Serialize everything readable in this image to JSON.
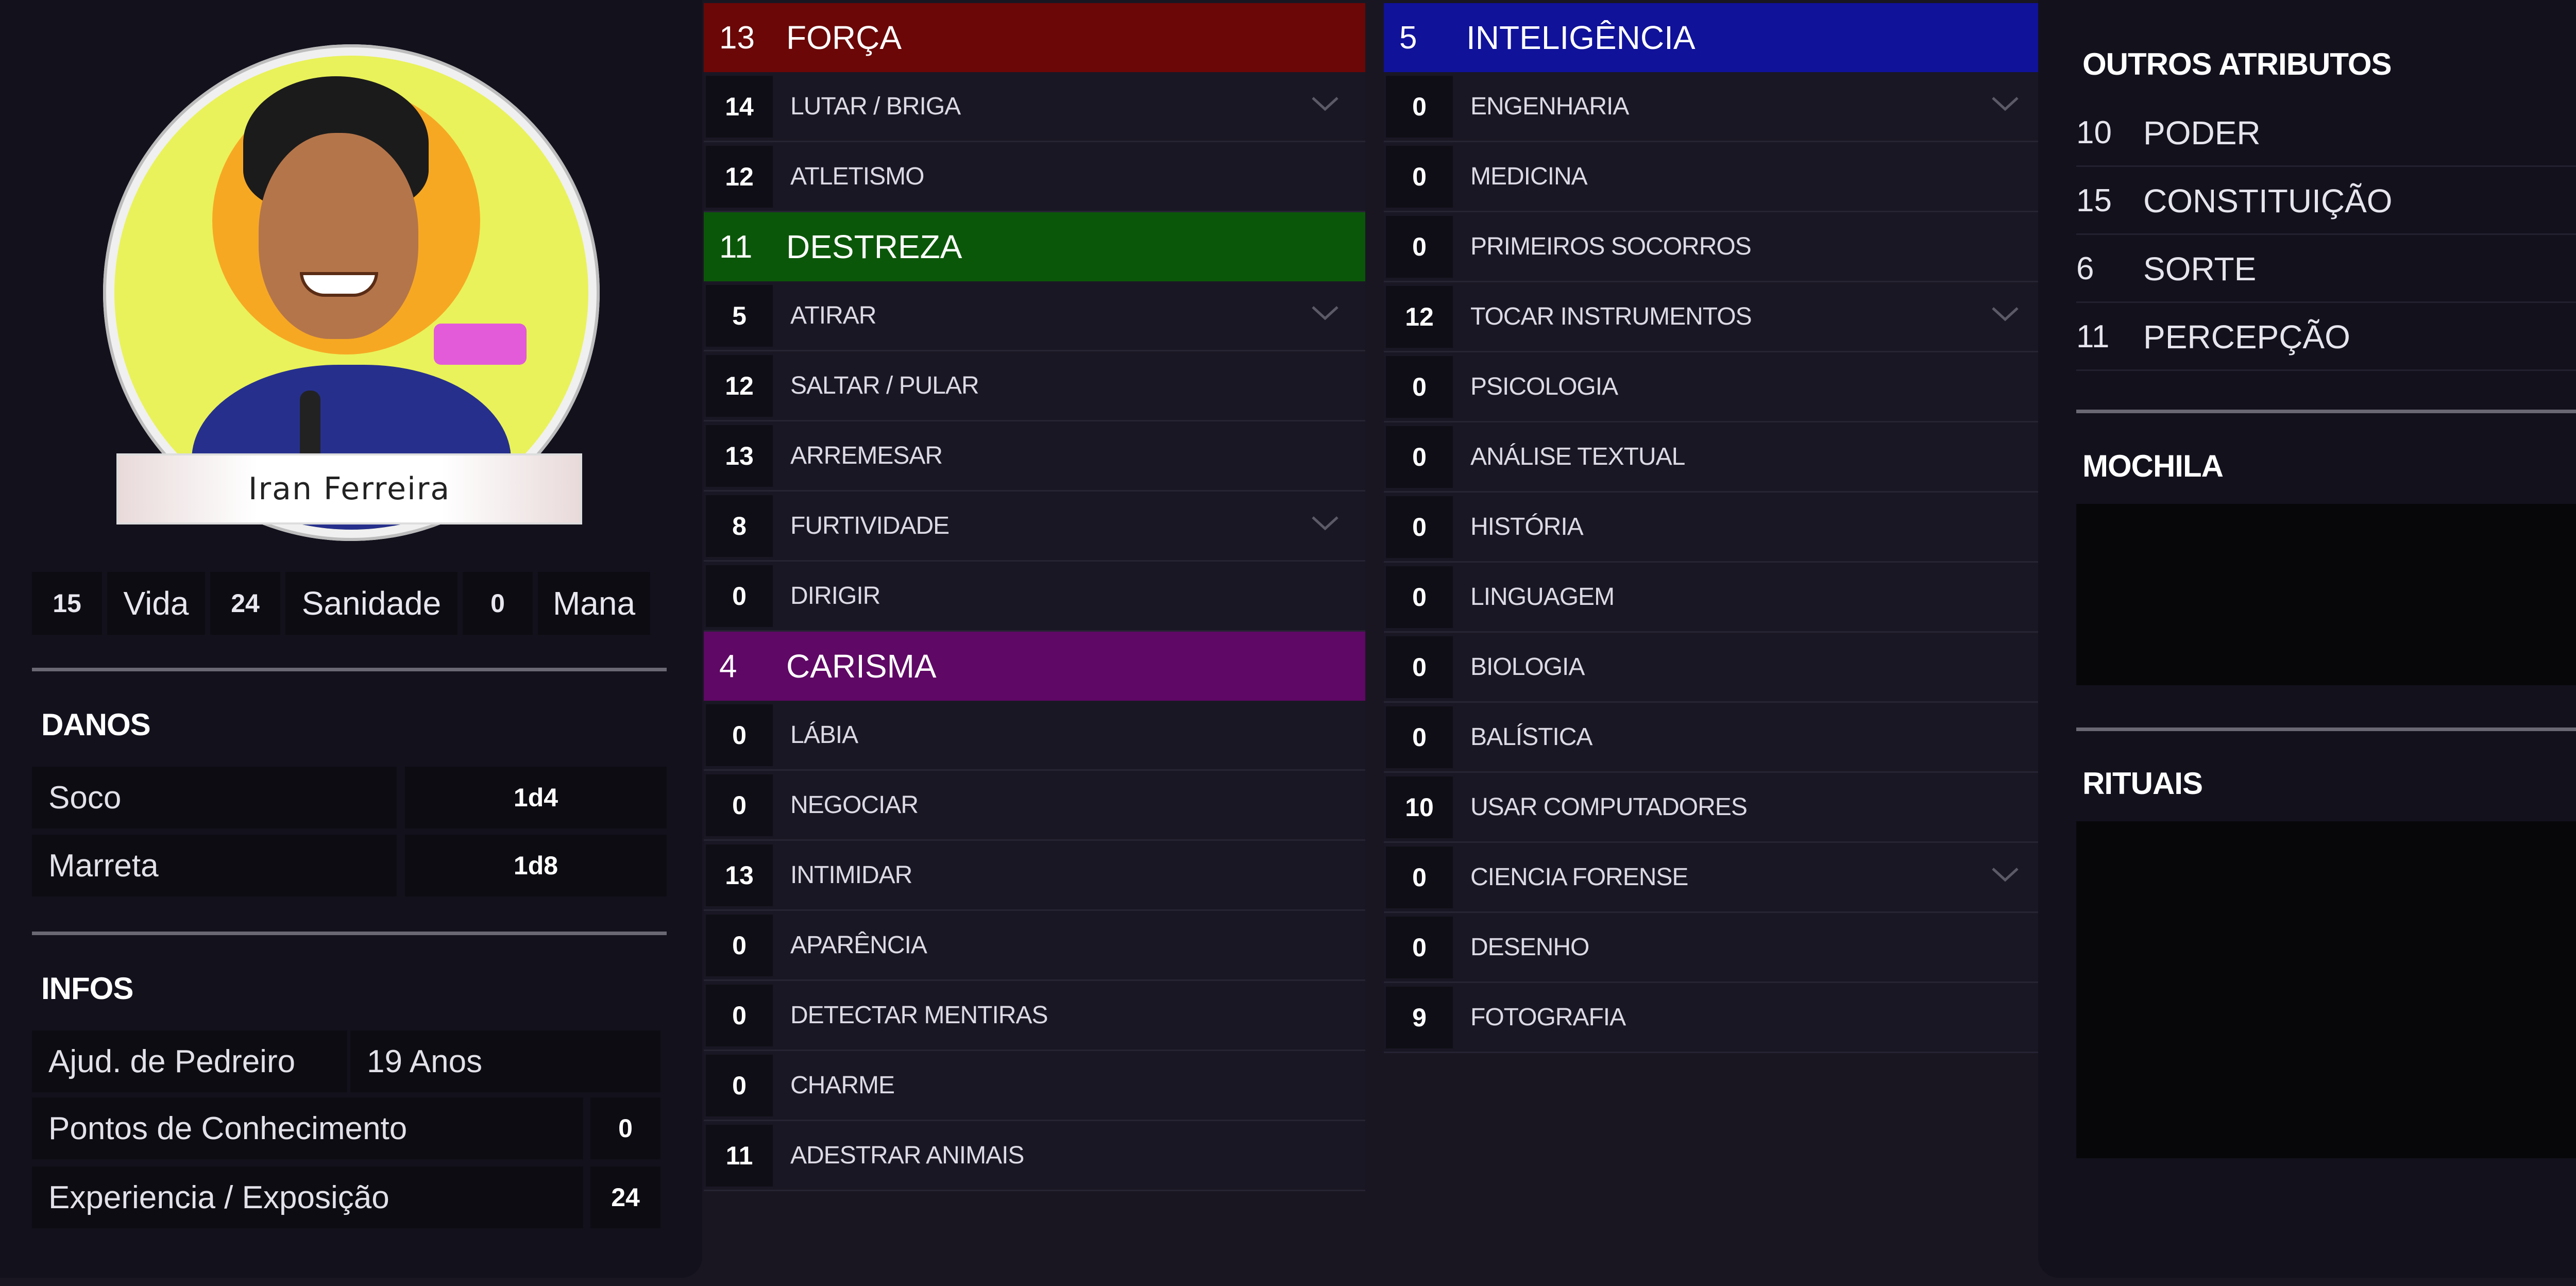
{
  "character": {
    "name": "Iran Ferreira"
  },
  "stats": [
    {
      "value": "15",
      "label": "Vida"
    },
    {
      "value": "24",
      "label": "Sanidade"
    },
    {
      "value": "0",
      "label": "Mana"
    }
  ],
  "danos": {
    "title": "DANOS",
    "items": [
      {
        "name": "Soco",
        "dice": "1d4"
      },
      {
        "name": "Marreta",
        "dice": "1d8"
      }
    ]
  },
  "infos": {
    "title": "INFOS",
    "occupation": "Ajud. de Pedreiro",
    "age": "19 Anos",
    "knowledge_label": "Pontos de Conhecimento",
    "knowledge_value": "0",
    "experience_label": "Experiencia / Exposição",
    "experience_value": "24"
  },
  "attributes": [
    {
      "value": "13",
      "name": "FORÇA",
      "color": "#6b0707",
      "skills": [
        {
          "value": "14",
          "name": "LUTAR / BRIGA",
          "expandable": true
        },
        {
          "value": "12",
          "name": "ATLETISMO",
          "expandable": false
        }
      ]
    },
    {
      "value": "11",
      "name": "DESTREZA",
      "color": "#0b5709",
      "skills": [
        {
          "value": "5",
          "name": "ATIRAR",
          "expandable": true
        },
        {
          "value": "12",
          "name": "SALTAR / PULAR",
          "expandable": false
        },
        {
          "value": "13",
          "name": "ARREMESAR",
          "expandable": false
        },
        {
          "value": "8",
          "name": "FURTIVIDADE",
          "expandable": true
        },
        {
          "value": "0",
          "name": "DIRIGIR",
          "expandable": false
        }
      ]
    },
    {
      "value": "4",
      "name": "CARISMA",
      "color": "#5f0865",
      "skills": [
        {
          "value": "0",
          "name": "LÁBIA",
          "expandable": false
        },
        {
          "value": "0",
          "name": "NEGOCIAR",
          "expandable": false
        },
        {
          "value": "13",
          "name": "INTIMIDAR",
          "expandable": false
        },
        {
          "value": "0",
          "name": "APARÊNCIA",
          "expandable": false
        },
        {
          "value": "0",
          "name": "DETECTAR MENTIRAS",
          "expandable": false
        },
        {
          "value": "0",
          "name": "CHARME",
          "expandable": false
        },
        {
          "value": "11",
          "name": "ADESTRAR ANIMAIS",
          "expandable": false
        }
      ]
    },
    {
      "value": "5",
      "name": "INTELIGÊNCIA",
      "color": "#10129a",
      "skills": [
        {
          "value": "0",
          "name": "ENGENHARIA",
          "expandable": true
        },
        {
          "value": "0",
          "name": "MEDICINA",
          "expandable": false
        },
        {
          "value": "0",
          "name": "PRIMEIROS SOCORROS",
          "expandable": false
        },
        {
          "value": "12",
          "name": "TOCAR INSTRUMENTOS",
          "expandable": true
        },
        {
          "value": "0",
          "name": "PSICOLOGIA",
          "expandable": false
        },
        {
          "value": "0",
          "name": "ANÁLISE TEXTUAL",
          "expandable": false
        },
        {
          "value": "0",
          "name": "HISTÓRIA",
          "expandable": false
        },
        {
          "value": "0",
          "name": "LINGUAGEM",
          "expandable": false
        },
        {
          "value": "0",
          "name": "BIOLOGIA",
          "expandable": false
        },
        {
          "value": "0",
          "name": "BALÍSTICA",
          "expandable": false
        },
        {
          "value": "10",
          "name": "USAR COMPUTADORES",
          "expandable": false
        },
        {
          "value": "0",
          "name": "CIENCIA FORENSE",
          "expandable": true
        },
        {
          "value": "0",
          "name": "DESENHO",
          "expandable": false
        },
        {
          "value": "9",
          "name": "FOTOGRAFIA",
          "expandable": false
        }
      ]
    }
  ],
  "outros": {
    "title": "OUTROS ATRIBUTOS",
    "items": [
      {
        "value": "10",
        "name": "PODER"
      },
      {
        "value": "15",
        "name": "CONSTITUIÇÃO"
      },
      {
        "value": "6",
        "name": "SORTE"
      },
      {
        "value": "11",
        "name": "PERCEPÇÃO"
      }
    ]
  },
  "mochila": {
    "title": "MOCHILA"
  },
  "rituais": {
    "title": "RITUAIS"
  }
}
